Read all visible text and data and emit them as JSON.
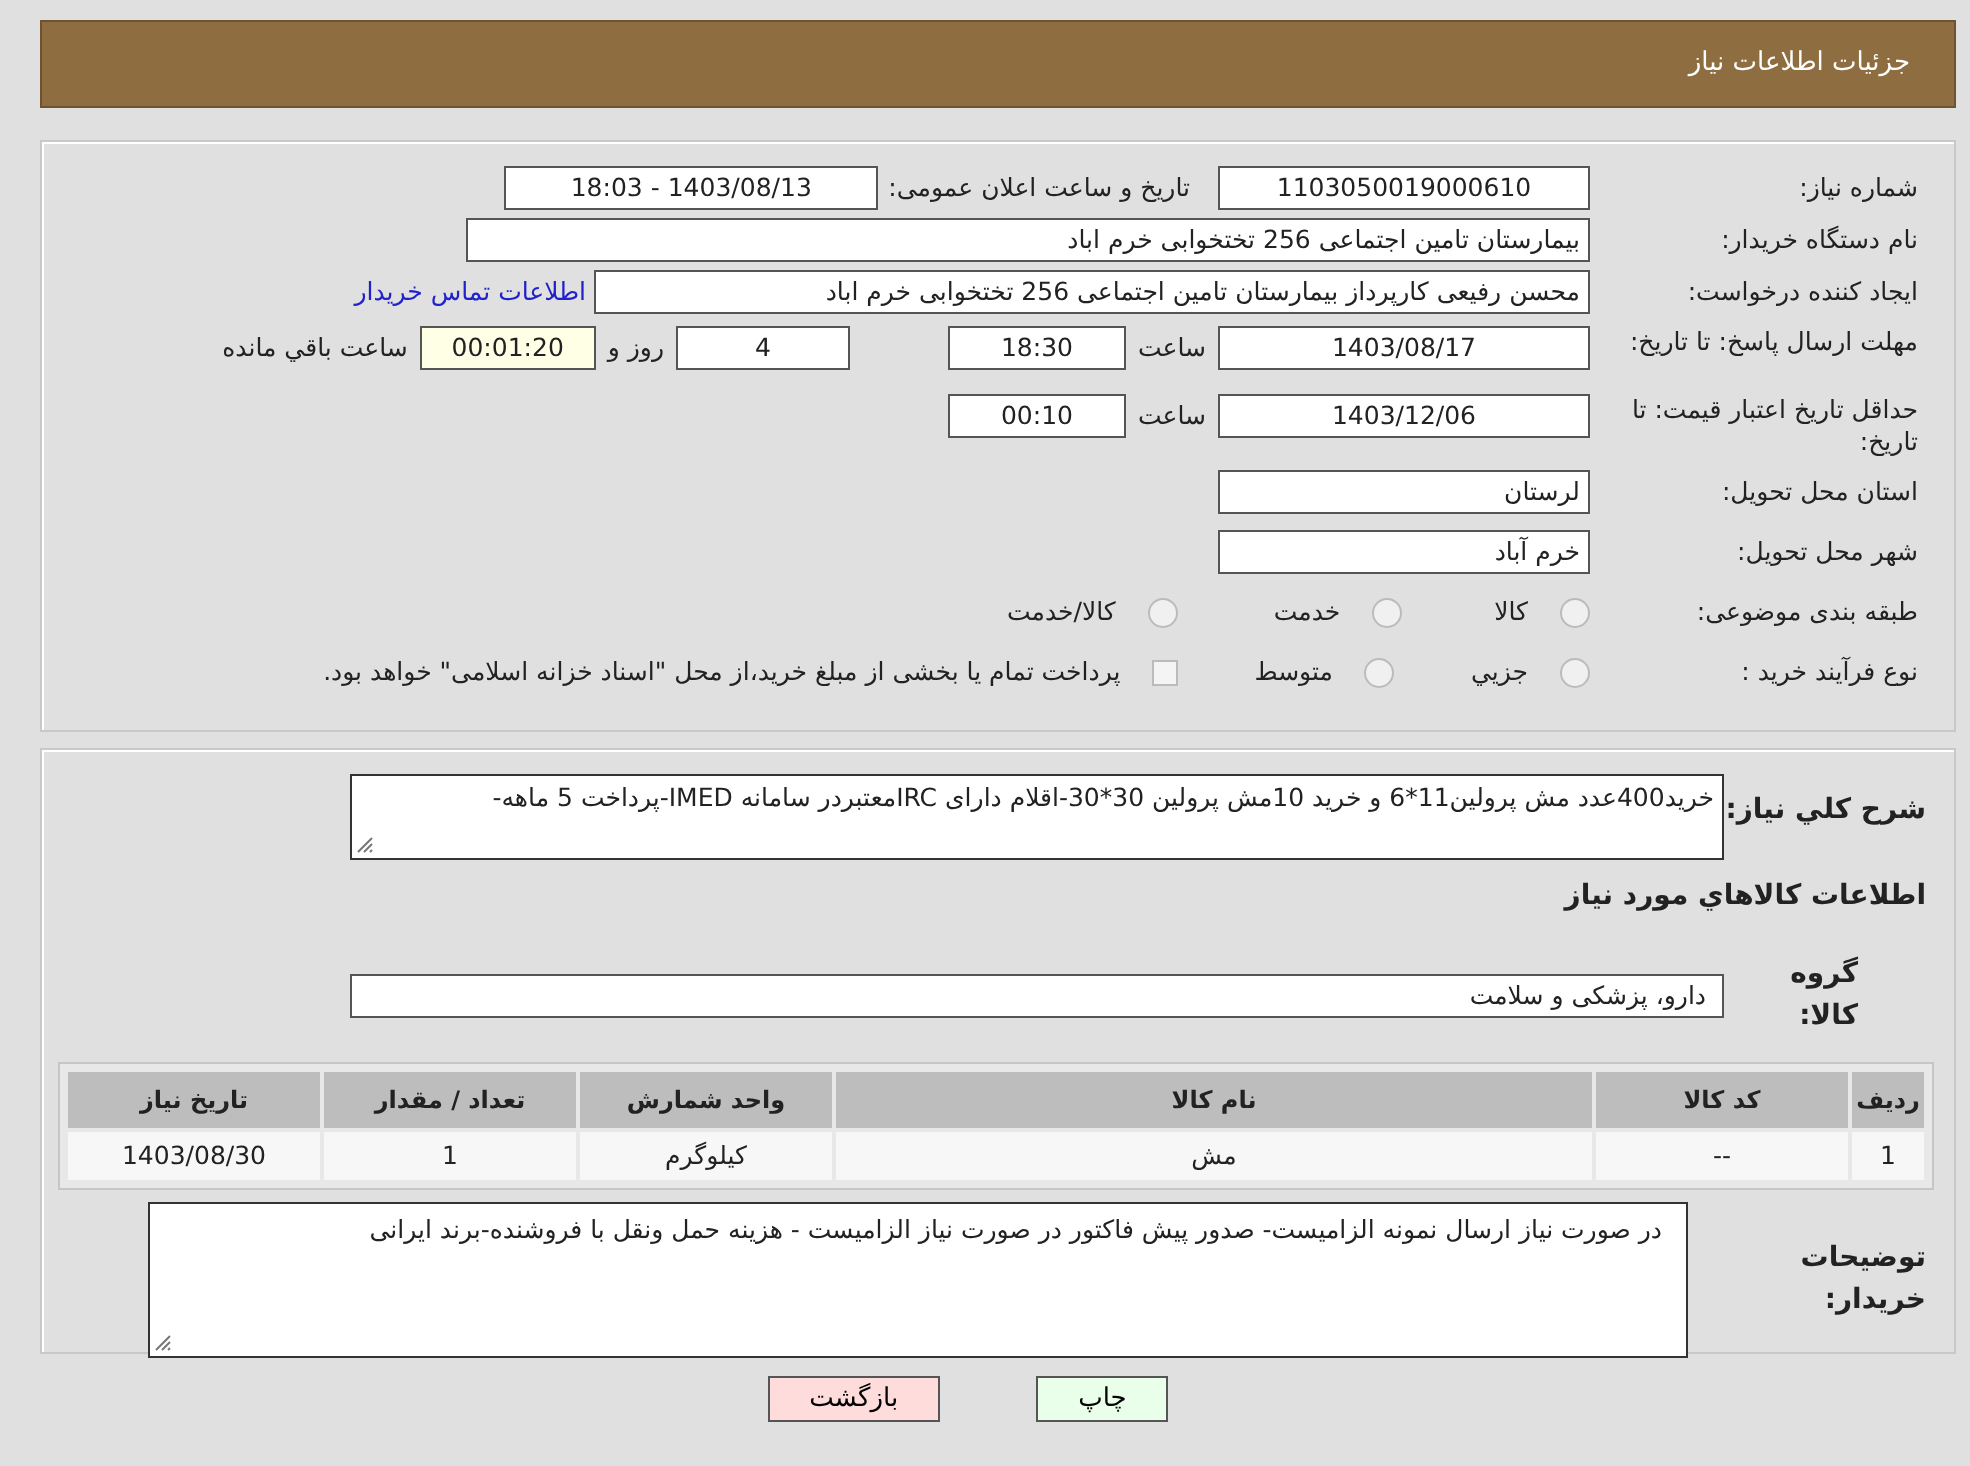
{
  "header": {
    "title": "جزئیات اطلاعات نیاز"
  },
  "need_number": {
    "label": "شماره نیاز:",
    "value": "1103050019000610"
  },
  "announce": {
    "label": "تاریخ و ساعت اعلان عمومی:",
    "value": "1403/08/13 - 18:03"
  },
  "buyer_org": {
    "label": "نام دستگاه خریدار:",
    "value": "بیمارستان تامین اجتماعی  256 تختخوابی خرم اباد"
  },
  "requester": {
    "label": "ایجاد کننده درخواست:",
    "value": "محسن رفیعی کارپرداز بیمارستان تامین اجتماعی  256 تختخوابی خرم اباد",
    "link": "اطلاعات تماس خریدار"
  },
  "reply_deadline": {
    "label": "مهلت ارسال پاسخ: تا تاریخ:",
    "date": "1403/08/17",
    "time_label": "ساعت",
    "time": "18:30",
    "days": "4",
    "days_label": "روز و",
    "remaining": "00:01:20",
    "remaining_label": "ساعت باقي مانده"
  },
  "price_validity": {
    "label": "حداقل تاریخ اعتبار قیمت: تا تاریخ:",
    "date": "1403/12/06",
    "time_label": "ساعت",
    "time": "00:10"
  },
  "province": {
    "label": "استان محل تحویل:",
    "value": "لرستان"
  },
  "city": {
    "label": "شهر محل تحویل:",
    "value": "خرم آباد"
  },
  "category": {
    "label": "طبقه بندی موضوعی:",
    "options": [
      {
        "label": "کالا",
        "kind": "radio",
        "selected": false
      },
      {
        "label": "خدمت",
        "kind": "radio",
        "selected": false
      },
      {
        "label": "کالا/خدمت",
        "kind": "radio",
        "selected": false
      }
    ]
  },
  "purchase_type": {
    "label": "نوع فرآیند خرید :",
    "options": [
      {
        "label": "جزيي",
        "kind": "radio",
        "selected": false
      },
      {
        "label": "متوسط",
        "kind": "radio",
        "selected": false
      },
      {
        "label": "پرداخت تمام یا بخشی از مبلغ خرید،از محل \"اسناد خزانه اسلامی\" خواهد بود.",
        "kind": "checkbox",
        "selected": false
      }
    ]
  },
  "description": {
    "label": "شرح کلي نياز:",
    "value": "خرید400عدد مش پرولین11*6 و خرید 10مش پرولین 30*30-اقلام دارای IRCمعتبردر سامانه IMED-پرداخت 5 ماهه-"
  },
  "goods_heading": "اطلاعات کالاهاي مورد نياز",
  "goods_group": {
    "label": "گروه کالا:",
    "value": "دارو، پزشکی و سلامت"
  },
  "table": {
    "columns": [
      "ردیف",
      "کد کالا",
      "نام کالا",
      "واحد شمارش",
      "تعداد / مقدار",
      "تاریخ نیاز"
    ],
    "rows": [
      [
        "1",
        "--",
        "مش",
        "کیلوگرم",
        "1",
        "1403/08/30"
      ]
    ]
  },
  "buyer_notes": {
    "label": "توضیحات خریدار:",
    "value": "در صورت نیاز ارسال نمونه الزامیست- صدور پیش فاکتور در صورت نیاز الزامیست - هزینه حمل ونقل با فروشنده-برند ایرانی"
  },
  "buttons": [
    {
      "label": "چاپ",
      "kind": "print"
    },
    {
      "label": "بازگشت",
      "kind": "back"
    }
  ]
}
